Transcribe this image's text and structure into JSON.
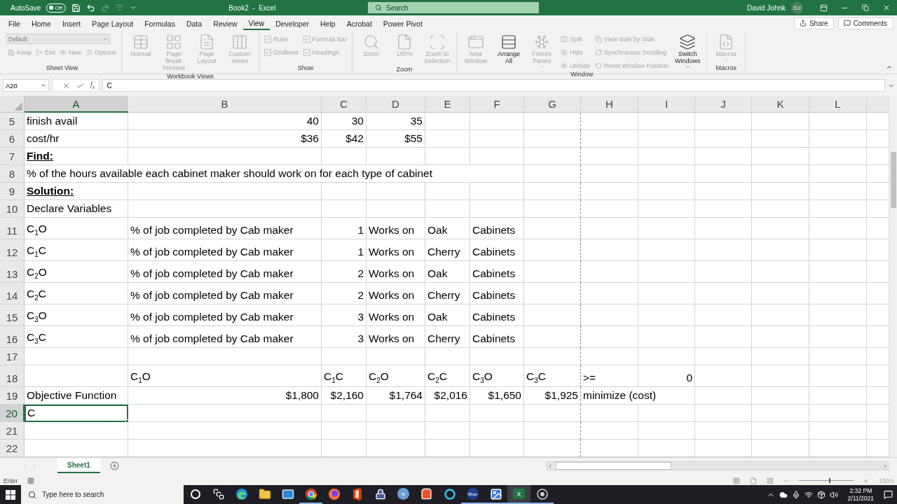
{
  "title_bar": {
    "autosave_label": "AutoSave",
    "autosave": {
      "on": false,
      "label": "Off"
    },
    "title": "Book2  -  Excel",
    "search_placeholder": "Search",
    "user": "David Johnk",
    "avatar": "DJ"
  },
  "menu": {
    "tabs": [
      {
        "label": "File",
        "selected": false
      },
      {
        "label": "Home",
        "selected": false
      },
      {
        "label": "Insert",
        "selected": false
      },
      {
        "label": "Page Layout",
        "selected": false
      },
      {
        "label": "Formulas",
        "selected": false
      },
      {
        "label": "Data",
        "selected": false
      },
      {
        "label": "Review",
        "selected": false
      },
      {
        "label": "View",
        "selected": true
      },
      {
        "label": "Developer",
        "selected": false
      },
      {
        "label": "Help",
        "selected": false
      },
      {
        "label": "Acrobat",
        "selected": false
      },
      {
        "label": "Power Pivot",
        "selected": false
      }
    ],
    "share": "Share",
    "comments": "Comments"
  },
  "ribbon": [
    {
      "label": "Sheet View",
      "items": [
        {
          "kind": "stack",
          "items": [
            {
              "kind": "dropdown",
              "label": "Default",
              "disabled": true
            },
            {
              "kind": "line",
              "items": [
                {
                  "kind": "small",
                  "label": "Keep",
                  "disabled": true
                },
                {
                  "kind": "small",
                  "label": "Exit",
                  "disabled": true
                },
                {
                  "kind": "small",
                  "label": "New",
                  "disabled": true
                },
                {
                  "kind": "small",
                  "label": "Options",
                  "disabled": true
                }
              ]
            }
          ]
        }
      ]
    },
    {
      "label": "Workbook Views",
      "items": [
        {
          "kind": "large",
          "label": "Normal",
          "disabled": true
        },
        {
          "kind": "large",
          "label": "Page Break Preview",
          "disabled": true
        },
        {
          "kind": "large",
          "label": "Page Layout",
          "disabled": true
        },
        {
          "kind": "large",
          "label": "Custom Views",
          "disabled": true
        }
      ]
    },
    {
      "label": "Show",
      "items": [
        {
          "kind": "stack",
          "items": [
            {
              "kind": "check",
              "label": "Ruler",
              "checked": true,
              "disabled": true
            },
            {
              "kind": "check",
              "label": "Gridlines",
              "checked": true,
              "disabled": true
            }
          ]
        },
        {
          "kind": "stack",
          "items": [
            {
              "kind": "check",
              "label": "Formula Bar",
              "checked": true,
              "disabled": true
            },
            {
              "kind": "check",
              "label": "Headings",
              "checked": true,
              "disabled": true
            }
          ]
        }
      ]
    },
    {
      "label": "Zoom",
      "items": [
        {
          "kind": "large",
          "label": "Zoom",
          "disabled": true
        },
        {
          "kind": "large",
          "label": "100%",
          "disabled": true
        },
        {
          "kind": "large",
          "label": "Zoom to Selection",
          "disabled": true
        }
      ]
    },
    {
      "label": "Window",
      "items": [
        {
          "kind": "large",
          "label": "New Window",
          "disabled": true
        },
        {
          "kind": "large",
          "label": "Arrange All",
          "disabled": false
        },
        {
          "kind": "large",
          "label": "Freeze Panes",
          "disabled": true,
          "caret": true
        },
        {
          "kind": "stack",
          "items": [
            {
              "kind": "small",
              "label": "Split",
              "disabled": true
            },
            {
              "kind": "small",
              "label": "Hide",
              "disabled": true
            },
            {
              "kind": "small",
              "label": "Unhide",
              "disabled": true
            }
          ]
        },
        {
          "kind": "stack",
          "items": [
            {
              "kind": "small",
              "label": "View Side by Side",
              "disabled": true
            },
            {
              "kind": "small",
              "label": "Synchronous Scrolling",
              "disabled": true
            },
            {
              "kind": "small",
              "label": "Reset Window Position",
              "disabled": true
            }
          ]
        },
        {
          "kind": "large",
          "label": "Switch Windows",
          "disabled": false,
          "caret": true
        }
      ]
    },
    {
      "label": "Macros",
      "items": [
        {
          "kind": "large",
          "label": "Macros",
          "disabled": true,
          "caret": true
        }
      ]
    }
  ],
  "formula_bar": {
    "name_box": "A20",
    "insert_function": "f$_{x}$",
    "value": "C"
  },
  "sheet": {
    "columns": [
      {
        "label": "A",
        "selected": true,
        "page_break_after": false
      },
      {
        "label": "B",
        "selected": false,
        "page_break_after": false
      },
      {
        "label": "C",
        "selected": false,
        "page_break_after": false
      },
      {
        "label": "D",
        "selected": false,
        "page_break_after": false
      },
      {
        "label": "E",
        "selected": false,
        "page_break_after": false
      },
      {
        "label": "F",
        "selected": false,
        "page_break_after": false
      },
      {
        "label": "G",
        "selected": false,
        "page_break_after": true
      },
      {
        "label": "H",
        "selected": false,
        "page_break_after": false
      },
      {
        "label": "I",
        "selected": false,
        "page_break_after": false
      },
      {
        "label": "J",
        "selected": false,
        "page_break_after": false
      },
      {
        "label": "K",
        "selected": false,
        "page_break_after": false
      },
      {
        "label": "L",
        "selected": false,
        "page_break_after": false
      }
    ],
    "rows": [
      {
        "number": "5",
        "selected": false,
        "cells": [
          {
            "kind": "text",
            "text": "finish avail"
          },
          {
            "kind": "number",
            "text": "40"
          },
          {
            "kind": "number",
            "text": "30"
          },
          {
            "kind": "number",
            "text": "35"
          }
        ]
      },
      {
        "number": "6",
        "selected": false,
        "cells": [
          {
            "kind": "text",
            "text": "cost/hr"
          },
          {
            "kind": "number",
            "text": "$36"
          },
          {
            "kind": "number",
            "text": "$42"
          },
          {
            "kind": "number",
            "text": "$55"
          }
        ]
      },
      {
        "number": "7",
        "selected": false,
        "cells": [
          {
            "kind": "heading",
            "text": "Find:"
          }
        ]
      },
      {
        "number": "8",
        "selected": false,
        "cells": [
          {
            "kind": "text",
            "text": "% of the hours available each cabinet maker should work on for each type of cabinet"
          }
        ]
      },
      {
        "number": "9",
        "selected": false,
        "cells": [
          {
            "kind": "heading",
            "text": "Solution:"
          }
        ]
      },
      {
        "number": "10",
        "selected": false,
        "cells": [
          {
            "kind": "text",
            "text": "Declare Variables"
          }
        ]
      },
      {
        "number": "11",
        "selected": false,
        "cells": [
          {
            "kind": "variable",
            "text": "C$_{1}$O"
          },
          {
            "kind": "text",
            "text": "% of job completed by Cab maker"
          },
          {
            "kind": "number",
            "text": "1"
          },
          {
            "kind": "text",
            "text": "Works on"
          },
          {
            "kind": "text",
            "text": "Oak"
          },
          {
            "kind": "text",
            "text": "Cabinets"
          }
        ]
      },
      {
        "number": "12",
        "selected": false,
        "cells": [
          {
            "kind": "variable",
            "text": "C$_{1}$C"
          },
          {
            "kind": "text",
            "text": "% of job completed by Cab maker"
          },
          {
            "kind": "number",
            "text": "1"
          },
          {
            "kind": "text",
            "text": "Works on"
          },
          {
            "kind": "text",
            "text": "Cherry"
          },
          {
            "kind": "text",
            "text": "Cabinets"
          }
        ]
      },
      {
        "number": "13",
        "selected": false,
        "cells": [
          {
            "kind": "variable",
            "text": "C$_{2}$O"
          },
          {
            "kind": "text",
            "text": "% of job completed by Cab maker"
          },
          {
            "kind": "number",
            "text": "2"
          },
          {
            "kind": "text",
            "text": "Works on"
          },
          {
            "kind": "text",
            "text": "Oak"
          },
          {
            "kind": "text",
            "text": "Cabinets"
          }
        ]
      },
      {
        "number": "14",
        "selected": false,
        "cells": [
          {
            "kind": "variable",
            "text": "C$_{2}$C"
          },
          {
            "kind": "text",
            "text": "% of job completed by Cab maker"
          },
          {
            "kind": "number",
            "text": "2"
          },
          {
            "kind": "text",
            "text": "Works on"
          },
          {
            "kind": "text",
            "text": "Cherry"
          },
          {
            "kind": "text",
            "text": "Cabinets"
          }
        ]
      },
      {
        "number": "15",
        "selected": false,
        "cells": [
          {
            "kind": "variable",
            "text": "C$_{3}$O"
          },
          {
            "kind": "text",
            "text": "% of job completed by Cab maker"
          },
          {
            "kind": "number",
            "text": "3"
          },
          {
            "kind": "text",
            "text": "Works on"
          },
          {
            "kind": "text",
            "text": "Oak"
          },
          {
            "kind": "text",
            "text": "Cabinets"
          }
        ]
      },
      {
        "number": "16",
        "selected": false,
        "cells": [
          {
            "kind": "variable",
            "text": "C$_{3}$C"
          },
          {
            "kind": "text",
            "text": "% of job completed by Cab maker"
          },
          {
            "kind": "number",
            "text": "3"
          },
          {
            "kind": "text",
            "text": "Works on"
          },
          {
            "kind": "text",
            "text": "Cherry"
          },
          {
            "kind": "text",
            "text": "Cabinets"
          }
        ]
      },
      {
        "number": "17",
        "selected": false,
        "cells": []
      },
      {
        "number": "18",
        "selected": false,
        "cells": [
          {
            "kind": "empty"
          },
          {
            "kind": "variable",
            "text": "C$_{1}$O"
          },
          {
            "kind": "variable",
            "text": "C$_{1}$C"
          },
          {
            "kind": "variable",
            "text": "C$_{2}$O"
          },
          {
            "kind": "variable",
            "text": "C$_{2}$C"
          },
          {
            "kind": "variable",
            "text": "C$_{3}$O"
          },
          {
            "kind": "variable",
            "text": "C$_{3}$C"
          },
          {
            "kind": "text",
            "text": ">="
          },
          {
            "kind": "number",
            "text": "0"
          }
        ]
      },
      {
        "number": "19",
        "selected": false,
        "cells": [
          {
            "kind": "text",
            "text": "Objective Function"
          },
          {
            "kind": "number",
            "text": "$1,800"
          },
          {
            "kind": "number",
            "text": "$2,160"
          },
          {
            "kind": "number",
            "text": "$1,764"
          },
          {
            "kind": "number",
            "text": "$2,016"
          },
          {
            "kind": "number",
            "text": "$1,650"
          },
          {
            "kind": "number",
            "text": "$1,925"
          },
          {
            "kind": "text",
            "text": "minimize (cost)"
          }
        ]
      },
      {
        "number": "20",
        "selected": true,
        "cells": [
          {
            "kind": "text",
            "text": "C"
          }
        ]
      },
      {
        "number": "21",
        "selected": false,
        "cells": []
      },
      {
        "number": "22",
        "selected": false,
        "cells": []
      }
    ]
  },
  "sheet_tabs": [
    {
      "label": "Sheet1",
      "selected": true
    }
  ],
  "status_bar": {
    "mode": "Enter",
    "zoom": "190%",
    "zoom_slider": {
      "level": 0.55
    }
  },
  "taskbar": {
    "search_placeholder": "Type here to search",
    "apps": [
      {
        "kind": "cortana",
        "running": false,
        "active": false
      },
      {
        "kind": "taskview",
        "running": false,
        "active": false
      },
      {
        "kind": "edge",
        "running": false,
        "active": false
      },
      {
        "kind": "explorer",
        "running": false,
        "active": false
      },
      {
        "kind": "mail",
        "running": false,
        "active": false
      },
      {
        "kind": "chrome",
        "running": true,
        "active": false
      },
      {
        "kind": "firefox",
        "running": false,
        "active": false
      },
      {
        "kind": "office",
        "running": false,
        "active": false
      },
      {
        "kind": "lock",
        "running": false,
        "active": false
      },
      {
        "kind": "badge",
        "label": "R",
        "color": "#6f9fd8",
        "running": false,
        "active": false
      },
      {
        "kind": "store",
        "running": false,
        "active": false
      },
      {
        "kind": "ring",
        "running": false,
        "active": false
      },
      {
        "kind": "badge",
        "label": "Blue",
        "color": "#1f3f8f",
        "running": true,
        "active": false
      },
      {
        "kind": "photos",
        "running": true,
        "active": false
      },
      {
        "kind": "excel",
        "label": "X",
        "running": true,
        "active": true
      },
      {
        "kind": "record",
        "running": true,
        "active": false
      }
    ],
    "time": "2:32 PM",
    "date": "2/11/2021"
  }
}
